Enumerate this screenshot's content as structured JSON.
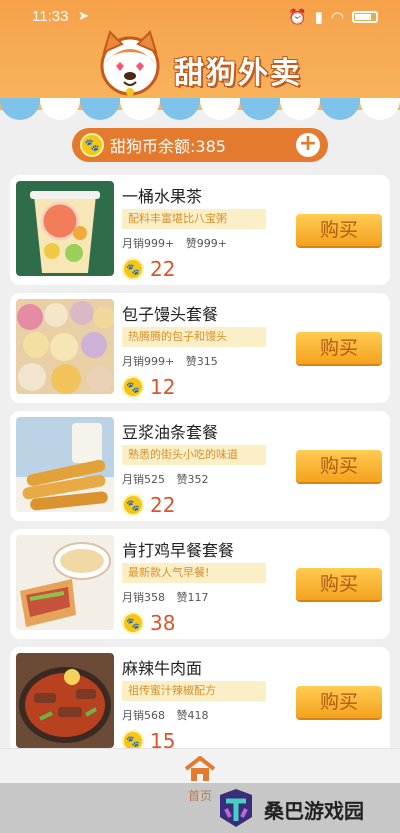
{
  "status_bar": {
    "time": "11:33"
  },
  "header": {
    "title": "甜狗外卖"
  },
  "balance": {
    "label": "甜狗币余额:385"
  },
  "items": [
    {
      "name": "一桶水果茶",
      "desc": "配料丰富堪比八宝粥",
      "sales": "月销999+",
      "likes": "赞999+",
      "price": "22",
      "buy": "购买"
    },
    {
      "name": "包子馒头套餐",
      "desc": "热腾腾的包子和馒头",
      "sales": "月销999+",
      "likes": "赞315",
      "price": "12",
      "buy": "购买"
    },
    {
      "name": "豆浆油条套餐",
      "desc": "熟悉的街头小吃的味道",
      "sales": "月销525",
      "likes": "赞352",
      "price": "22",
      "buy": "购买"
    },
    {
      "name": "肯打鸡早餐套餐",
      "desc": "最新款人气早餐!",
      "sales": "月销358",
      "likes": "赞117",
      "price": "38",
      "buy": "购买"
    },
    {
      "name": "麻辣牛肉面",
      "desc": "祖传蜜汁辣椒配方",
      "sales": "月销568",
      "likes": "赞418",
      "price": "15",
      "buy": "购买"
    }
  ],
  "nav": {
    "home": "首页"
  },
  "watermark": {
    "text": "桑巴游戏园"
  },
  "colors": {
    "accent": "#e37a2e",
    "header": "#f6a24a",
    "price": "#d9562a"
  }
}
